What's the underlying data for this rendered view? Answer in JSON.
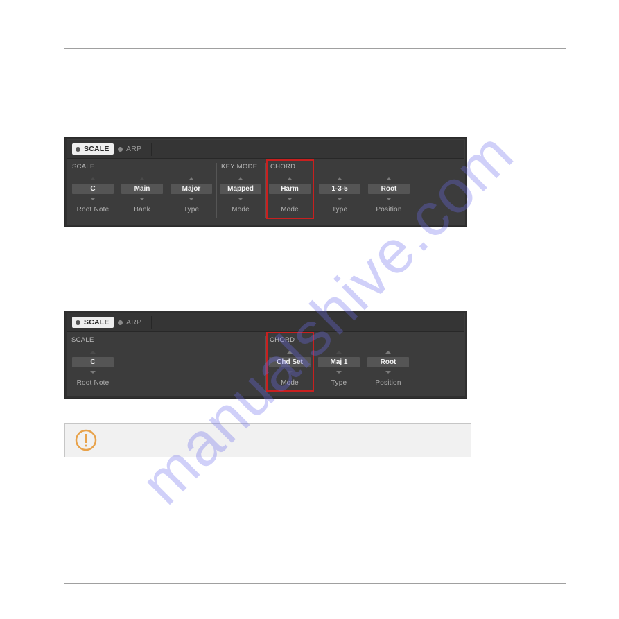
{
  "watermark": "manualshive.com",
  "panels": [
    {
      "tabs": [
        {
          "label": "SCALE",
          "active": true
        },
        {
          "label": "ARP",
          "active": false
        }
      ],
      "sections": {
        "scale": "SCALE",
        "key_mode": "KEY MODE",
        "chord": "CHORD"
      },
      "controls": [
        {
          "value": "C",
          "label": "Root Note",
          "up_enabled": false,
          "down_enabled": true
        },
        {
          "value": "Main",
          "label": "Bank",
          "up_enabled": false,
          "down_enabled": true
        },
        {
          "value": "Major",
          "label": "Type",
          "up_enabled": true,
          "down_enabled": true
        },
        {
          "value": "Mapped",
          "label": "Mode",
          "up_enabled": true,
          "down_enabled": true
        },
        {
          "value": "Harm",
          "label": "Mode",
          "up_enabled": true,
          "down_enabled": true,
          "highlighted": true
        },
        {
          "value": "1-3-5",
          "label": "Type",
          "up_enabled": true,
          "down_enabled": true
        },
        {
          "value": "Root",
          "label": "Position",
          "up_enabled": true,
          "down_enabled": true
        }
      ]
    },
    {
      "tabs": [
        {
          "label": "SCALE",
          "active": true
        },
        {
          "label": "ARP",
          "active": false
        }
      ],
      "sections": {
        "scale": "SCALE",
        "chord": "CHORD"
      },
      "controls": [
        {
          "value": "C",
          "label": "Root Note",
          "up_enabled": false,
          "down_enabled": true
        },
        {
          "value": "Chd Set",
          "label": "Mode",
          "up_enabled": true,
          "down_enabled": false,
          "highlighted": true
        },
        {
          "value": "Maj 1",
          "label": "Type",
          "up_enabled": false,
          "down_enabled": true
        },
        {
          "value": "Root",
          "label": "Position",
          "up_enabled": true,
          "down_enabled": true
        }
      ]
    }
  ],
  "callout": {
    "icon": "warning-icon",
    "icon_color": "#e8a24a",
    "text": ""
  },
  "colors": {
    "highlight": "#c8201f",
    "panel_bg": "#3c3c3c"
  }
}
